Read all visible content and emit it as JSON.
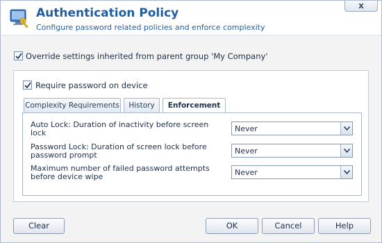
{
  "header": {
    "title": "Authentication Policy",
    "subtitle": "Configure password related policies and enforce complexity",
    "close_label": "x",
    "icon": "lock-key-icon"
  },
  "override": {
    "label": "Override settings inherited from parent group 'My Company'",
    "checked": true
  },
  "require_password": {
    "label": "Require password on device",
    "checked": true
  },
  "tabs": [
    {
      "label": "Complexity Requirements",
      "active": false
    },
    {
      "label": "History",
      "active": false
    },
    {
      "label": "Enforcement",
      "active": true
    }
  ],
  "enforcement": {
    "fields": [
      {
        "label": "Auto Lock: Duration of inactivity before screen lock",
        "value": "Never"
      },
      {
        "label": "Password Lock: Duration of screen lock before password prompt",
        "value": "Never"
      },
      {
        "label": "Maximum number of failed password attempts before device wipe",
        "value": "Never"
      }
    ]
  },
  "footer": {
    "clear_label": "Clear",
    "ok_label": "OK",
    "cancel_label": "Cancel",
    "help_label": "Help"
  },
  "colors": {
    "title": "#1f5e9f",
    "text": "#1c2f4a",
    "border": "#a8b8cc"
  }
}
